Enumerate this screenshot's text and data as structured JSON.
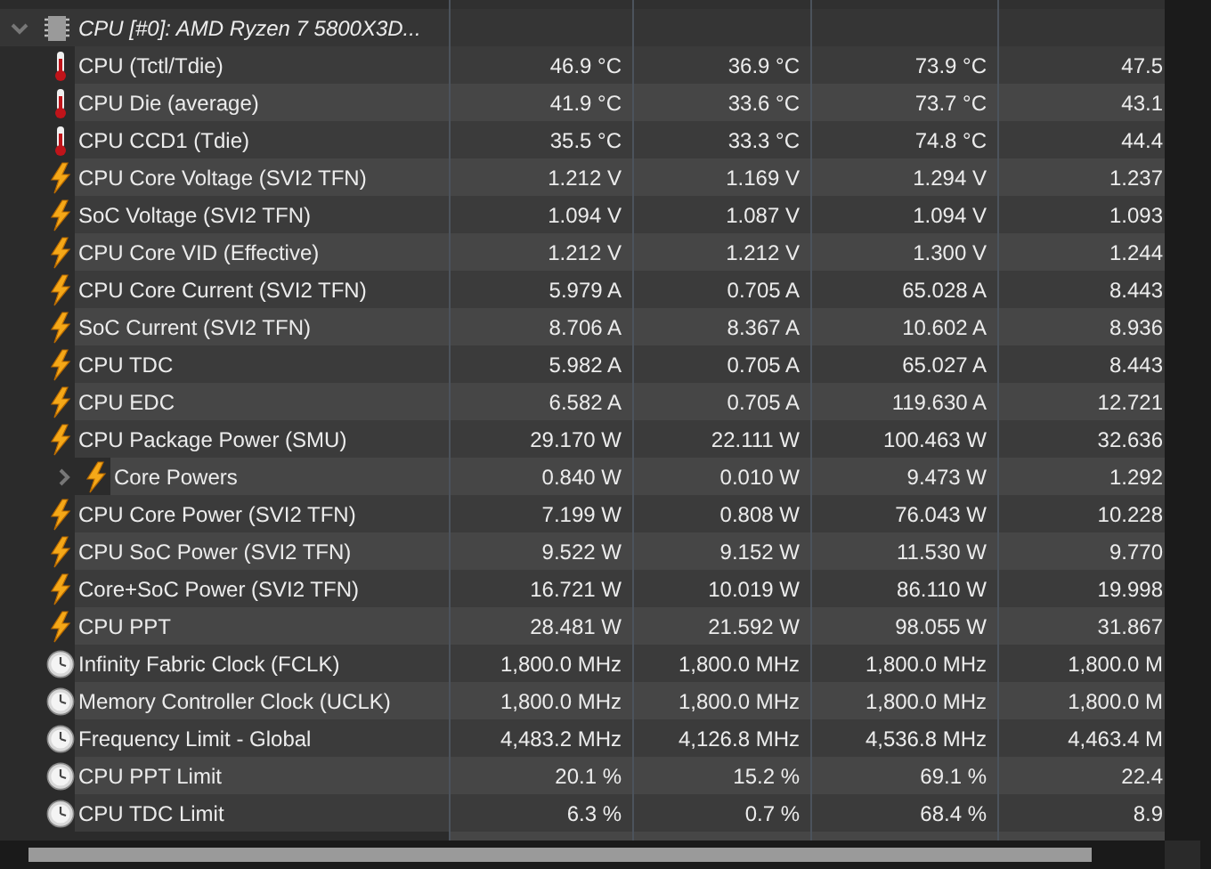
{
  "sensor_group": {
    "label": "CPU [#0]: AMD Ryzen 7 5800X3D...",
    "expanded": true,
    "children": [
      {
        "label": "CPU (Tctl/Tdie)",
        "kind": "temperature",
        "values": [
          "46.9 °C",
          "36.9 °C",
          "73.9 °C",
          "47.5"
        ]
      },
      {
        "label": "CPU Die (average)",
        "kind": "temperature",
        "values": [
          "41.9 °C",
          "33.6 °C",
          "73.7 °C",
          "43.1"
        ]
      },
      {
        "label": "CPU CCD1 (Tdie)",
        "kind": "temperature",
        "values": [
          "35.5 °C",
          "33.3 °C",
          "74.8 °C",
          "44.4"
        ]
      },
      {
        "label": "CPU Core Voltage (SVI2 TFN)",
        "kind": "power",
        "values": [
          "1.212 V",
          "1.169 V",
          "1.294 V",
          "1.237"
        ]
      },
      {
        "label": "SoC Voltage (SVI2 TFN)",
        "kind": "power",
        "values": [
          "1.094 V",
          "1.087 V",
          "1.094 V",
          "1.093"
        ]
      },
      {
        "label": "CPU Core VID (Effective)",
        "kind": "power",
        "values": [
          "1.212 V",
          "1.212 V",
          "1.300 V",
          "1.244"
        ]
      },
      {
        "label": "CPU Core Current (SVI2 TFN)",
        "kind": "power",
        "values": [
          "5.979 A",
          "0.705 A",
          "65.028 A",
          "8.443"
        ]
      },
      {
        "label": "SoC Current (SVI2 TFN)",
        "kind": "power",
        "values": [
          "8.706 A",
          "8.367 A",
          "10.602 A",
          "8.936"
        ]
      },
      {
        "label": "CPU TDC",
        "kind": "power",
        "values": [
          "5.982 A",
          "0.705 A",
          "65.027 A",
          "8.443"
        ]
      },
      {
        "label": "CPU EDC",
        "kind": "power",
        "values": [
          "6.582 A",
          "0.705 A",
          "119.630 A",
          "12.721"
        ]
      },
      {
        "label": "CPU Package Power (SMU)",
        "kind": "power",
        "values": [
          "29.170 W",
          "22.111 W",
          "100.463 W",
          "32.636"
        ]
      },
      {
        "label": "Core Powers",
        "kind": "power",
        "expanded": false,
        "values": [
          "0.840 W",
          "0.010 W",
          "9.473 W",
          "1.292"
        ]
      },
      {
        "label": "CPU Core Power (SVI2 TFN)",
        "kind": "power",
        "values": [
          "7.199 W",
          "0.808 W",
          "76.043 W",
          "10.228"
        ]
      },
      {
        "label": "CPU SoC Power (SVI2 TFN)",
        "kind": "power",
        "values": [
          "9.522 W",
          "9.152 W",
          "11.530 W",
          "9.770"
        ]
      },
      {
        "label": "Core+SoC Power (SVI2 TFN)",
        "kind": "power",
        "values": [
          "16.721 W",
          "10.019 W",
          "86.110 W",
          "19.998"
        ]
      },
      {
        "label": "CPU PPT",
        "kind": "power",
        "values": [
          "28.481 W",
          "21.592 W",
          "98.055 W",
          "31.867"
        ]
      },
      {
        "label": "Infinity Fabric Clock (FCLK)",
        "kind": "clock",
        "values": [
          "1,800.0 MHz",
          "1,800.0 MHz",
          "1,800.0 MHz",
          "1,800.0 M"
        ]
      },
      {
        "label": "Memory Controller Clock (UCLK)",
        "kind": "clock",
        "values": [
          "1,800.0 MHz",
          "1,800.0 MHz",
          "1,800.0 MHz",
          "1,800.0 M"
        ]
      },
      {
        "label": "Frequency Limit - Global",
        "kind": "clock",
        "values": [
          "4,483.2 MHz",
          "4,126.8 MHz",
          "4,536.8 MHz",
          "4,463.4 M"
        ]
      },
      {
        "label": "CPU PPT Limit",
        "kind": "clock",
        "values": [
          "20.1 %",
          "15.2 %",
          "69.1 %",
          "22.4"
        ]
      },
      {
        "label": "CPU TDC Limit",
        "kind": "clock",
        "values": [
          "6.3 %",
          "0.7 %",
          "68.4 %",
          "8.9"
        ]
      }
    ]
  }
}
